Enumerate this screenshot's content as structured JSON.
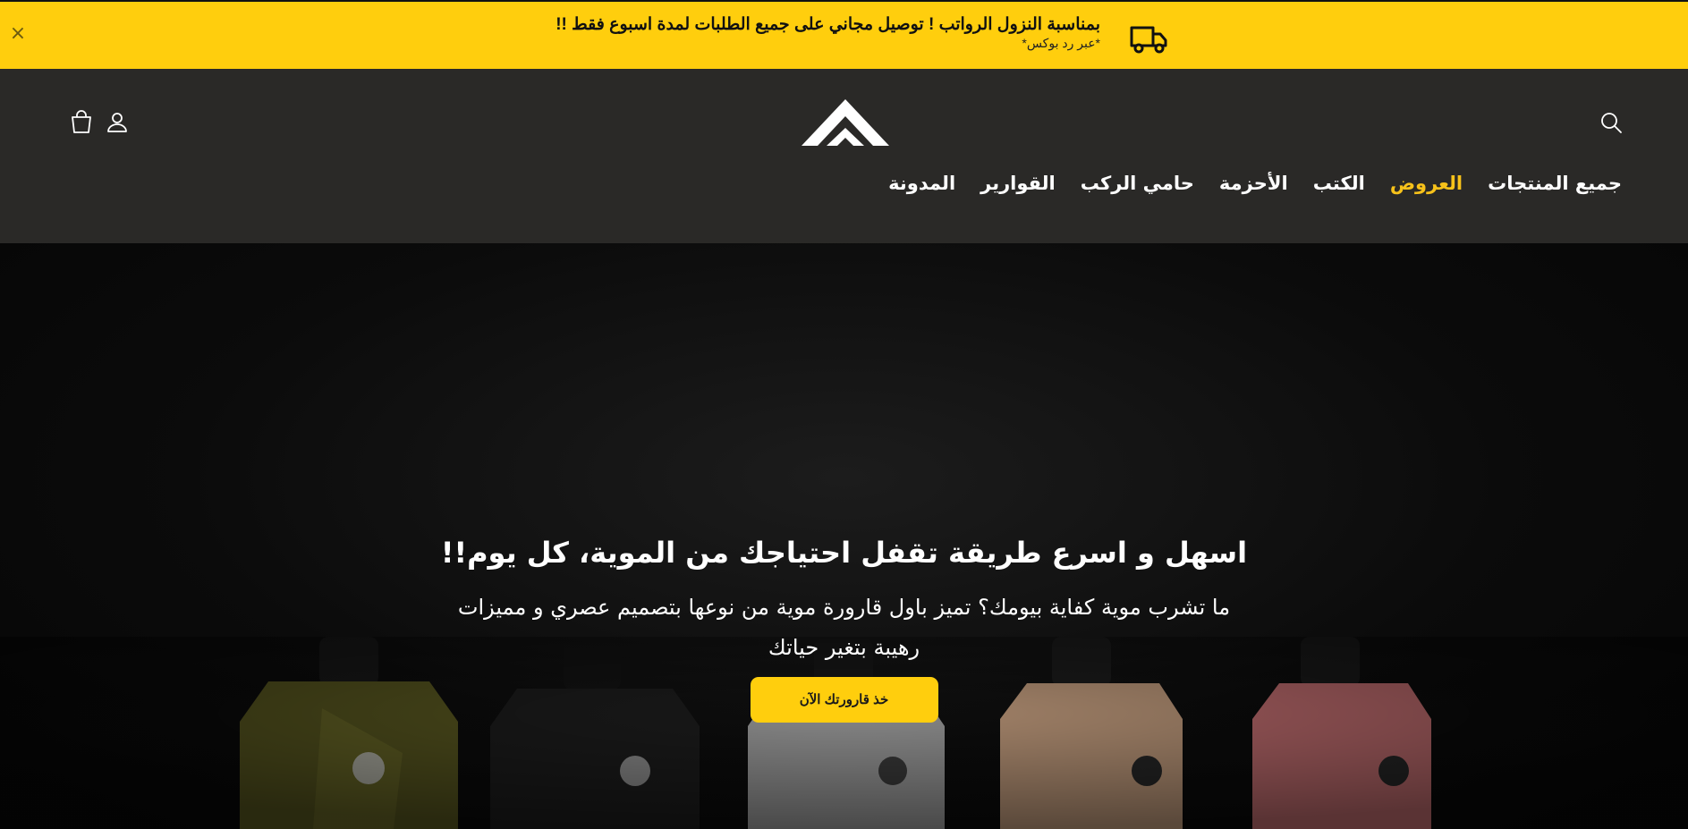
{
  "announcement": {
    "close_label": "×",
    "main_text": "بمناسبة النزول الرواتب ! توصيل مجاني على جميع الطلبات لمدة اسبوع فقط !!",
    "sub_text": "*عبر رد بوكس*",
    "icon": "delivery-truck-icon"
  },
  "header": {
    "icons": {
      "search": "search-icon",
      "account": "user-icon",
      "cart": "cart-icon",
      "logo": "brand-logo"
    },
    "nav": [
      {
        "label": "جميع المنتجات",
        "active": false
      },
      {
        "label": "العروض",
        "active": true
      },
      {
        "label": "الكتب",
        "active": false
      },
      {
        "label": "الأحزمة",
        "active": false
      },
      {
        "label": "حامي الركب",
        "active": false
      },
      {
        "label": "القوارير",
        "active": false
      },
      {
        "label": "المدونة",
        "active": false
      }
    ],
    "active_color": "#f7c21a",
    "background": "#2a2927"
  },
  "hero": {
    "title": "اسهل و اسرع طريقة تقفل احتياجك من الموية، كل يوم!!",
    "description": "ما تشرب موية كفاية بيومك؟ تميز باول قارورة موية من نوعها بتصميم عصري و مميزات رهيبة بتغير حياتك",
    "cta_label": "خذ قارورتك الآن",
    "cta_color": "#ffce0d",
    "bottle_colors": [
      "#4a4a1c",
      "#161616",
      "#8a8a8a",
      "#a0826a",
      "#a35f5f"
    ]
  }
}
